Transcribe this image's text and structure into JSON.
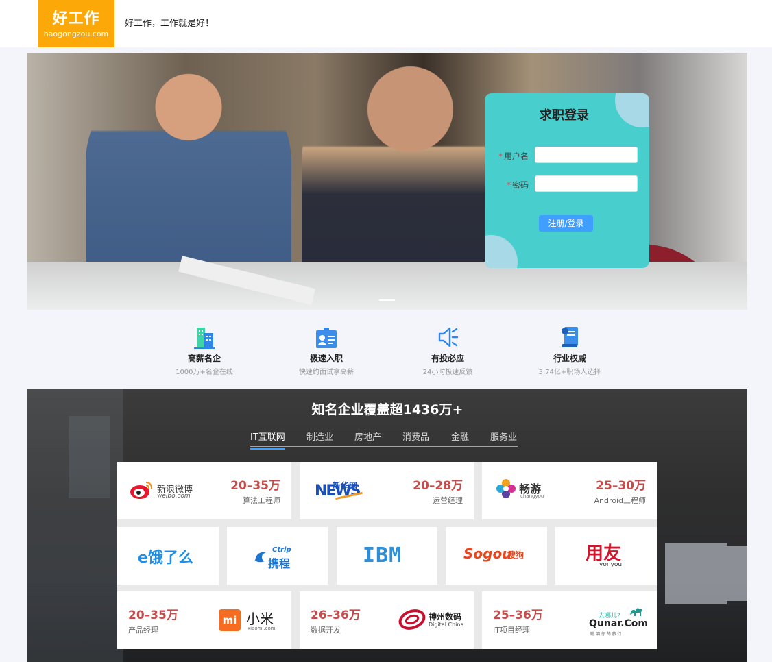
{
  "header": {
    "logo_cn": "好工作",
    "logo_en": "haogongzou.com",
    "slogan": "好工作，工作就是好！"
  },
  "login": {
    "title": "求职登录",
    "username_label": "用户名",
    "password_label": "密码",
    "required_mark": "*",
    "submit_label": "注册/登录"
  },
  "features": [
    {
      "icon": "building-icon",
      "title": "高薪名企",
      "subtitle": "1000万+名企在线"
    },
    {
      "icon": "id-card-icon",
      "title": "极速入职",
      "subtitle": "快速约面试拿高薪"
    },
    {
      "icon": "megaphone-icon",
      "title": "有投必应",
      "subtitle": "24小时极速反馈"
    },
    {
      "icon": "certificate-icon",
      "title": "行业权威",
      "subtitle": "3.74亿+职场人选择"
    }
  ],
  "companies": {
    "title": "知名企业覆盖超1436万+",
    "tabs": [
      "IT互联网",
      "制造业",
      "房地产",
      "消费品",
      "金融",
      "服务业"
    ],
    "active_tab": "IT互联网",
    "top_row": [
      {
        "logo_text": "新浪微博",
        "logo_sub": "weibo.com",
        "salary": "20–35万",
        "job": "算法工程师"
      },
      {
        "logo_text": "新华网",
        "logo_sub": "NEWS",
        "salary": "20–28万",
        "job": "运营经理"
      },
      {
        "logo_text": "畅游",
        "logo_sub": "changyou",
        "salary": "25–30万",
        "job": "Android工程师"
      }
    ],
    "middle_row": [
      {
        "logo_text": "饿了么",
        "logo_prefix": "e"
      },
      {
        "logo_text": "携程",
        "logo_sub": "Ctrip"
      },
      {
        "logo_text": "IBM"
      },
      {
        "logo_text": "Sogou",
        "logo_sub": "搜狗"
      },
      {
        "logo_text": "用友",
        "logo_sub": "yonyou"
      }
    ],
    "bottom_row": [
      {
        "logo_text": "小米",
        "logo_sub": "xiaomi.com",
        "logo_badge": "mi",
        "salary": "20–35万",
        "job": "产品经理"
      },
      {
        "logo_text": "神州数码",
        "logo_sub": "Digital China",
        "salary": "26–36万",
        "job": "数据开发"
      },
      {
        "logo_text": "Qunar.Com",
        "logo_sub": "去哪儿?",
        "logo_tagline": "聪 明 你 的 旅 行",
        "salary": "25–36万",
        "job": "IT项目经理"
      }
    ],
    "colors": {
      "salary": "#c94a4a",
      "tab_underline": "#409eff"
    }
  },
  "colors": {
    "logo_bg": "#fca809",
    "login_bg": "#48cfcd",
    "button": "#409eff"
  }
}
